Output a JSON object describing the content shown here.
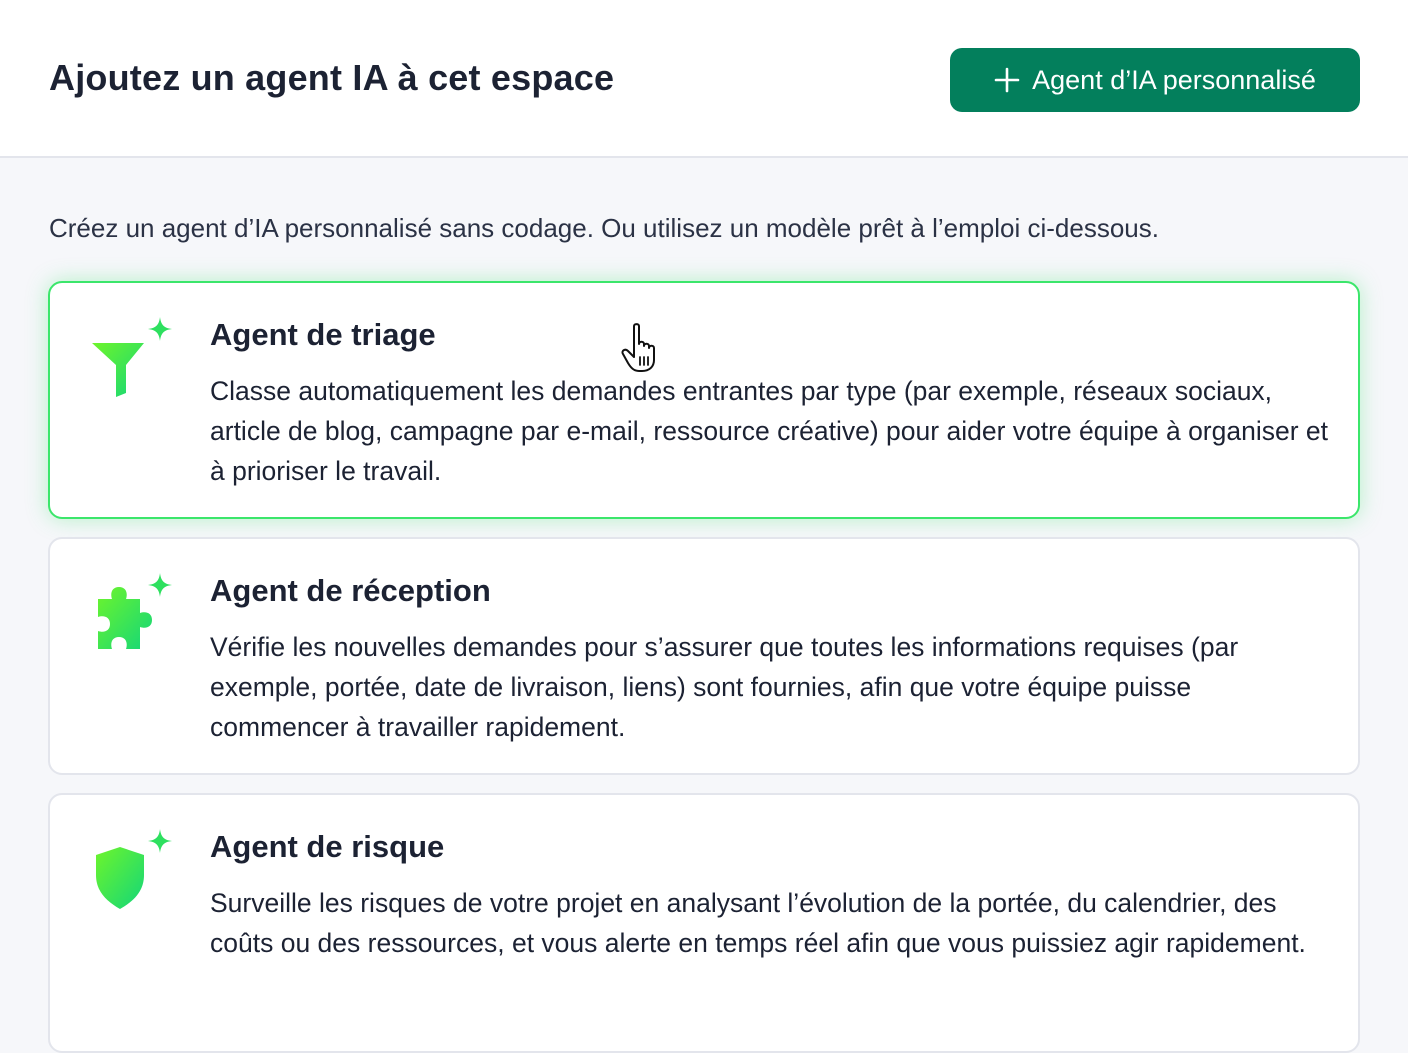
{
  "header": {
    "title": "Ajoutez un agent IA à cet espace",
    "custom_agent_button_label": "Agent d’IA personnalisé"
  },
  "intro": "Créez un agent d’IA personnalisé sans codage. Ou utilisez un modèle prêt à l’emploi ci-dessous.",
  "agents": [
    {
      "title": "Agent de triage",
      "description": "Classe automatiquement les demandes entrantes par type (par exemple, réseaux sociaux, article de blog, campagne par e-mail, ressource créative) pour aider votre équipe à organiser et à prioriser le travail.",
      "icon": "funnel-sparkle-icon",
      "selected": true
    },
    {
      "title": "Agent de réception",
      "description": "Vérifie les nouvelles demandes pour s’assurer que toutes les informations requises (par exemple, portée, date de livraison, liens) sont fournies, afin que votre équipe puisse commencer à travailler rapidement.",
      "icon": "puzzle-sparkle-icon",
      "selected": false
    },
    {
      "title": "Agent de risque",
      "description": "Surveille les risques de votre projet en analysant l’évolution de la portée, du calendrier, des coûts ou des ressources, et vous alerte en temps réel afin que vous puissiez agir rapidement.",
      "icon": "shield-sparkle-icon",
      "selected": false
    }
  ],
  "colors": {
    "primary_button": "#037f5c",
    "selected_border": "#3be66b",
    "icon_gradient_start": "#6ef52a",
    "icon_gradient_end": "#12d67a"
  }
}
